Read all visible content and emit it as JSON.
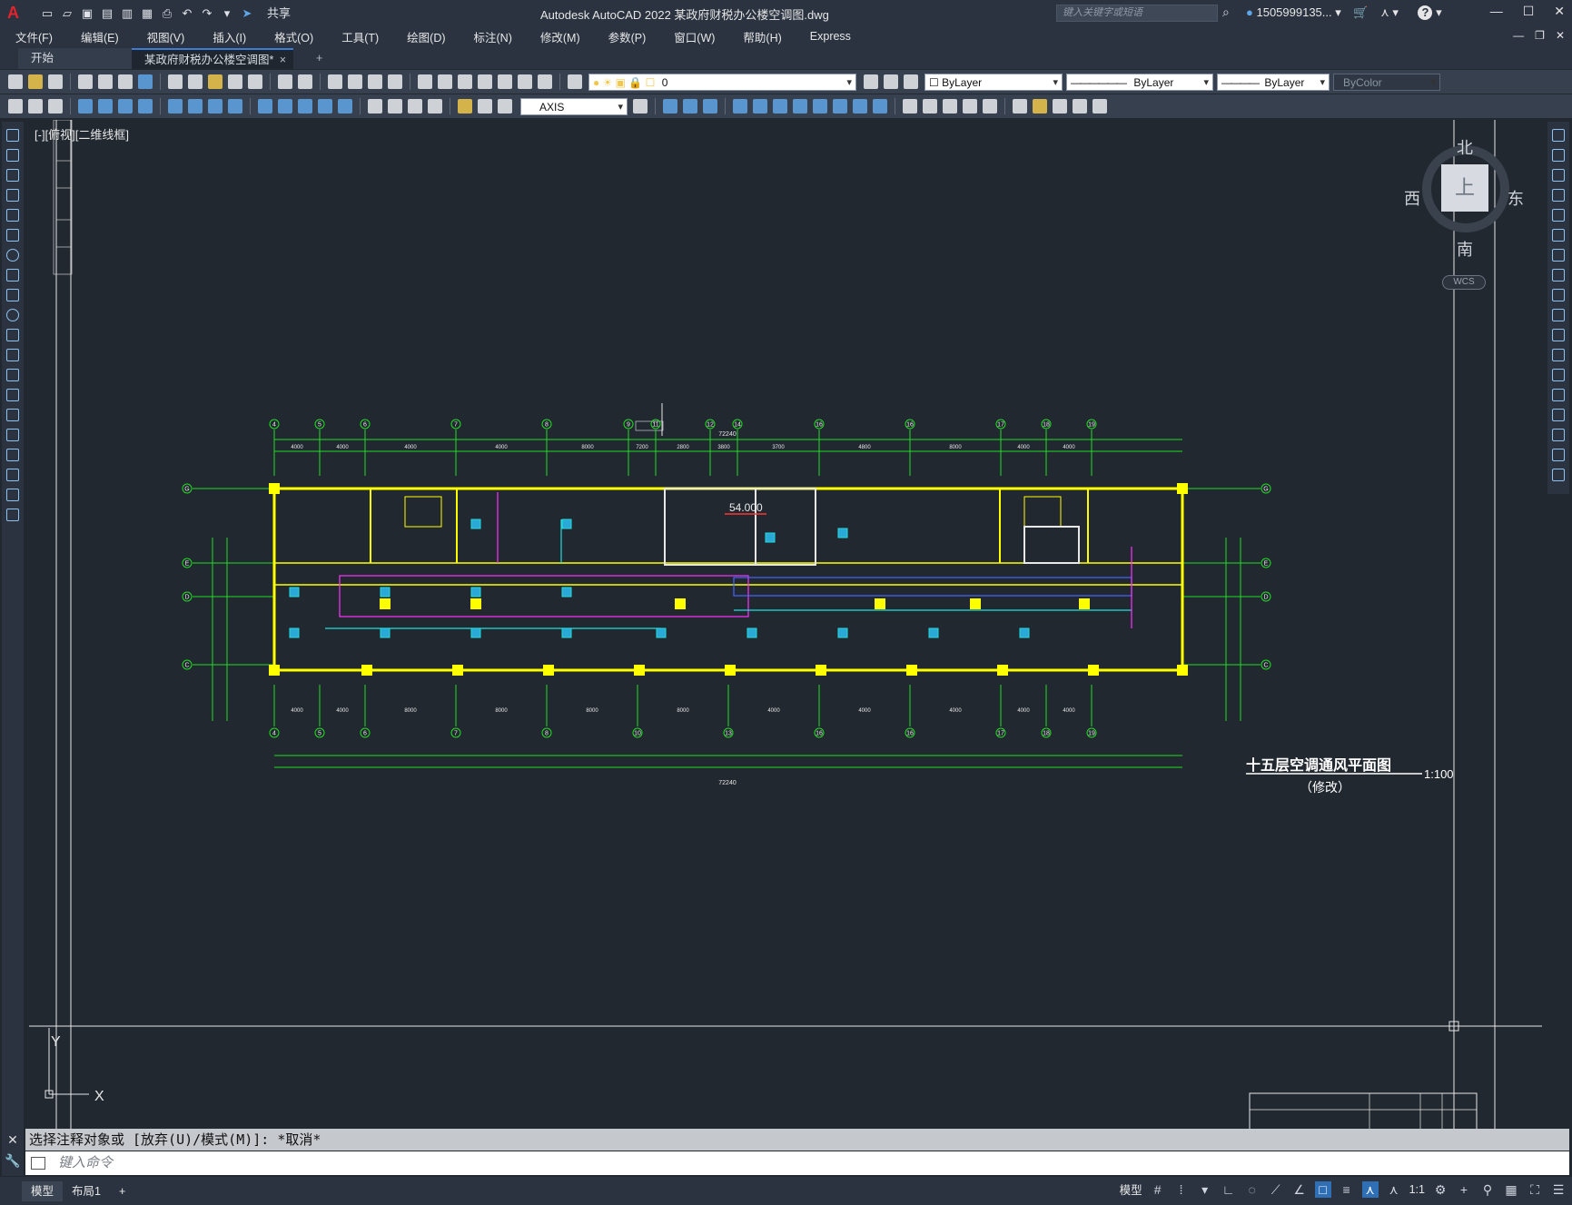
{
  "titlebar": {
    "app_logo": "A",
    "share_label": "共享",
    "title": "Autodesk AutoCAD 2022    某政府财税办公楼空调图.dwg",
    "search_placeholder": "键入关键字或短语",
    "user": "1505999135...",
    "help": "?"
  },
  "menu": [
    "文件(F)",
    "编辑(E)",
    "视图(V)",
    "插入(I)",
    "格式(O)",
    "工具(T)",
    "绘图(D)",
    "标注(N)",
    "修改(M)",
    "参数(P)",
    "窗口(W)",
    "帮助(H)",
    "Express"
  ],
  "tabs": {
    "start": "开始",
    "doc": "某政府财税办公楼空调图*",
    "close": "×",
    "add": "+"
  },
  "toolbar": {
    "layer_value": "0",
    "color": "ByLayer",
    "linetype": "ByLayer",
    "lineweight": "ByLayer",
    "plotstyle": "ByColor",
    "dimstyle": "AXIS"
  },
  "viewport_label": "[-][俯视][二维线框]",
  "viewcube": {
    "north": "北",
    "south": "南",
    "east": "东",
    "west": "西",
    "top": "上",
    "wcs": "WCS"
  },
  "drawing": {
    "title": "十五层空调通风平面图",
    "scale": "1:100",
    "subtitle": "（修改）",
    "elevation": "54.000",
    "total_width_top": "72240",
    "total_width_bottom": "72240",
    "axes_top": [
      "4",
      "5",
      "6",
      "7",
      "8",
      "9",
      "11",
      "12",
      "14",
      "16",
      "16",
      "17",
      "18",
      "19"
    ],
    "axes_bottom": [
      "4",
      "5",
      "6",
      "7",
      "8",
      "10",
      "13",
      "16",
      "16",
      "17",
      "18",
      "19"
    ],
    "axes_left": [
      "G",
      "E",
      "D",
      "C"
    ],
    "axes_right": [
      "G",
      "E",
      "D",
      "C"
    ],
    "top_dims": [
      "4000",
      "4000",
      "4000",
      "4000",
      "8000",
      "7200",
      "2800",
      "3800",
      "3700",
      "4800",
      "8000",
      "4000",
      "4000",
      "4000"
    ],
    "bottom_dims": [
      "4000",
      "4000",
      "8000",
      "8000",
      "8000",
      "8000",
      "4000",
      "4000",
      "4000",
      "4000",
      "4000"
    ]
  },
  "command": {
    "history": "选择注释对象或 [放弃(U)/模式(M)]: *取消*",
    "placeholder": "键入命令"
  },
  "status": {
    "model_tab": "模型",
    "layout_tab": "布局1",
    "add": "+",
    "model_btn": "模型",
    "scale": "1:1"
  }
}
